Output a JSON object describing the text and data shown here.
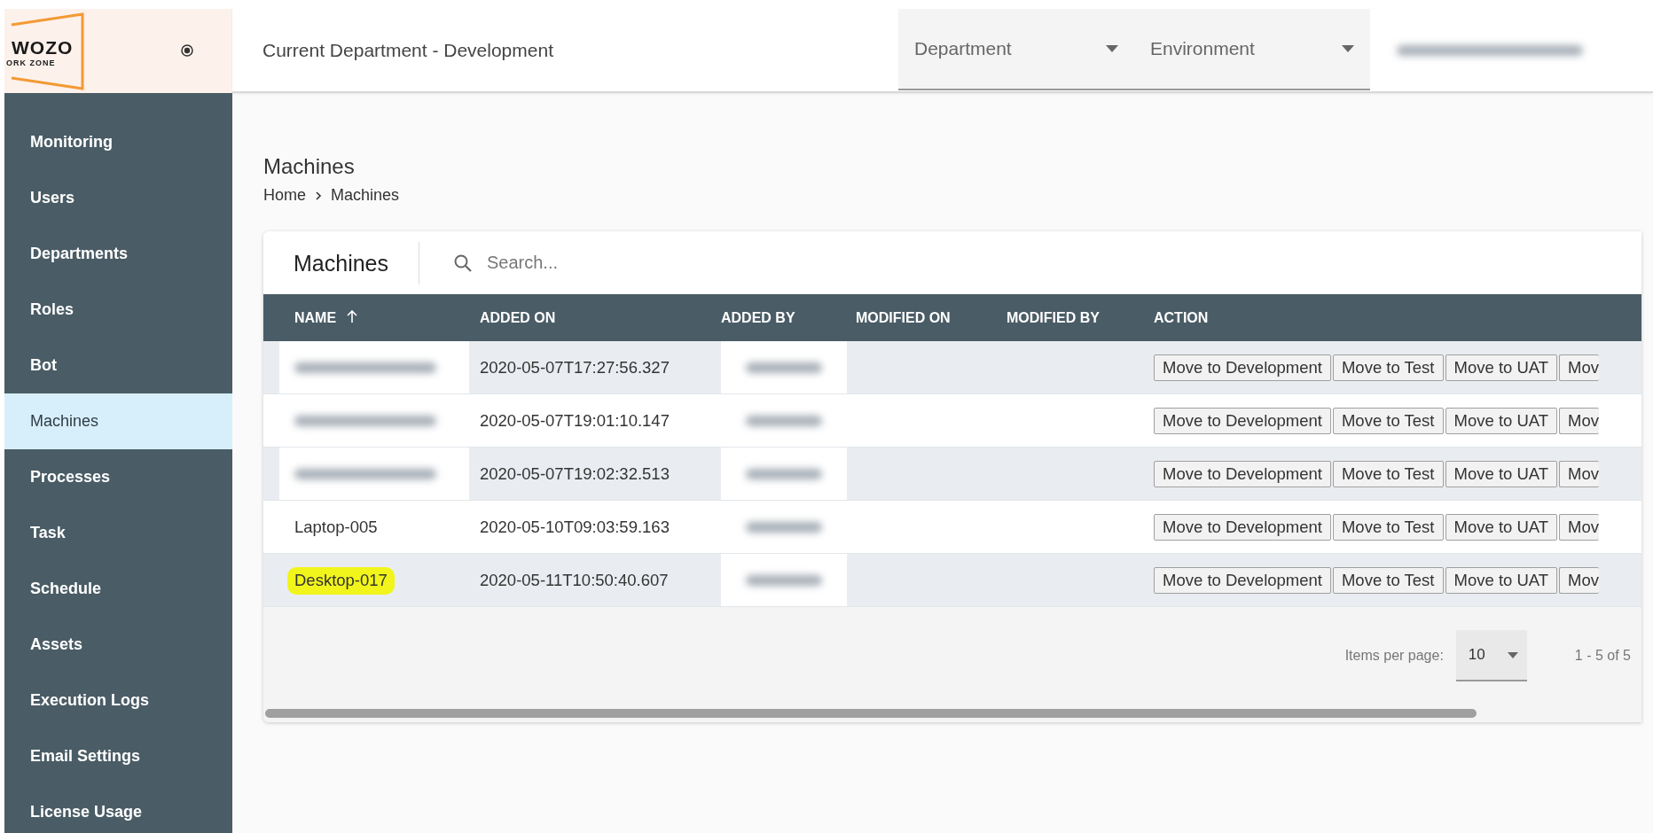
{
  "logo": {
    "word": "WOZO",
    "tagline": "ORK ZONE"
  },
  "header": {
    "title": "Current Department - Development",
    "dropdowns": [
      {
        "label": "Department"
      },
      {
        "label": "Environment"
      }
    ],
    "user_blurred": true
  },
  "sidebar": {
    "items": [
      {
        "label": "Monitoring",
        "selected": false
      },
      {
        "label": "Users",
        "selected": false
      },
      {
        "label": "Departments",
        "selected": false
      },
      {
        "label": "Roles",
        "selected": false
      },
      {
        "label": "Bot",
        "selected": false
      },
      {
        "label": "Machines",
        "selected": true
      },
      {
        "label": "Processes",
        "selected": false
      },
      {
        "label": "Task",
        "selected": false
      },
      {
        "label": "Schedule",
        "selected": false
      },
      {
        "label": "Assets",
        "selected": false
      },
      {
        "label": "Execution Logs",
        "selected": false
      },
      {
        "label": "Email Settings",
        "selected": false
      },
      {
        "label": "License Usage",
        "selected": false
      }
    ]
  },
  "page": {
    "title": "Machines",
    "breadcrumb": [
      "Home",
      "Machines"
    ]
  },
  "card": {
    "title": "Machines",
    "search": {
      "placeholder": "Search..."
    }
  },
  "table": {
    "columns": [
      {
        "label": "NAME",
        "sorted": true
      },
      {
        "label": "ADDED ON",
        "sorted": false
      },
      {
        "label": "ADDED BY",
        "sorted": false
      },
      {
        "label": "MODIFIED ON",
        "sorted": false
      },
      {
        "label": "MODIFIED BY",
        "sorted": false
      },
      {
        "label": "ACTION",
        "sorted": false
      }
    ],
    "rows": [
      {
        "name_blurred": true,
        "highlighted": false,
        "added_on": "2020-05-07T17:27:56.327",
        "added_by_blurred": true,
        "actions": [
          "Move to Development",
          "Move to Test",
          "Move to UAT",
          "Mov"
        ]
      },
      {
        "name_blurred": true,
        "highlighted": false,
        "added_on": "2020-05-07T19:01:10.147",
        "added_by_blurred": true,
        "actions": [
          "Move to Development",
          "Move to Test",
          "Move to UAT",
          "Mov"
        ]
      },
      {
        "name_blurred": true,
        "highlighted": false,
        "added_on": "2020-05-07T19:02:32.513",
        "added_by_blurred": true,
        "actions": [
          "Move to Development",
          "Move to Test",
          "Move to UAT",
          "Mov"
        ]
      },
      {
        "name": "Laptop-005",
        "name_blurred": false,
        "highlighted": false,
        "added_on": "2020-05-10T09:03:59.163",
        "added_by_blurred": true,
        "actions": [
          "Move to Development",
          "Move to Test",
          "Move to UAT",
          "Mov"
        ]
      },
      {
        "name": "Desktop-017",
        "name_blurred": false,
        "highlighted": true,
        "added_on": "2020-05-11T10:50:40.607",
        "added_by_blurred": true,
        "actions": [
          "Move to Development",
          "Move to Test",
          "Move to UAT",
          "Mov"
        ]
      }
    ]
  },
  "paginator": {
    "label": "Items per page:",
    "page_size": "10",
    "range": "1 - 5 of 5"
  }
}
